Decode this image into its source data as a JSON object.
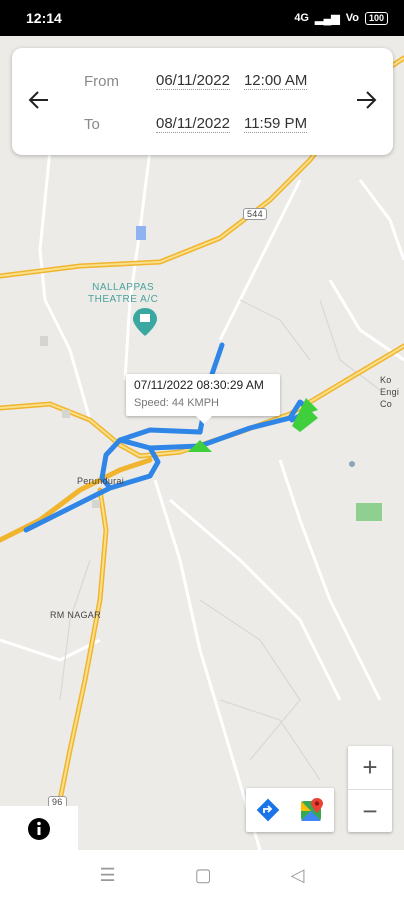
{
  "status_bar": {
    "time": "12:14",
    "network": "4G",
    "signal": "Vo",
    "battery": "100"
  },
  "date_range": {
    "from_label": "From",
    "from_date": "06/11/2022",
    "from_time": "12:00 AM",
    "to_label": "To",
    "to_date": "08/11/2022",
    "to_time": "11:59 PM"
  },
  "map": {
    "tooltip": {
      "timestamp": "07/11/2022 08:30:29 AM",
      "speed": "Speed: 44 KMPH"
    },
    "labels": {
      "poi_name_line1": "NALLAPPAS",
      "poi_name_line2": "THEATRE A/C",
      "town": "Perundurai",
      "rm_nagar": "RM NAGAR",
      "road_544": "544",
      "road_96": "96",
      "college_1": "Ko",
      "college_2": "Engi",
      "college_3": "Co"
    },
    "colors": {
      "route": "#2f86e6",
      "highway": "#f5c243",
      "marker": "#3fcf3c"
    }
  },
  "controls": {
    "zoom_in": "+",
    "zoom_out": "−",
    "directions_icon": "directions-icon",
    "google_maps_icon": "google-maps-icon",
    "info_icon": "info-icon"
  },
  "nav_bar": {
    "menu": "☰",
    "home": "▢",
    "back": "◁"
  }
}
